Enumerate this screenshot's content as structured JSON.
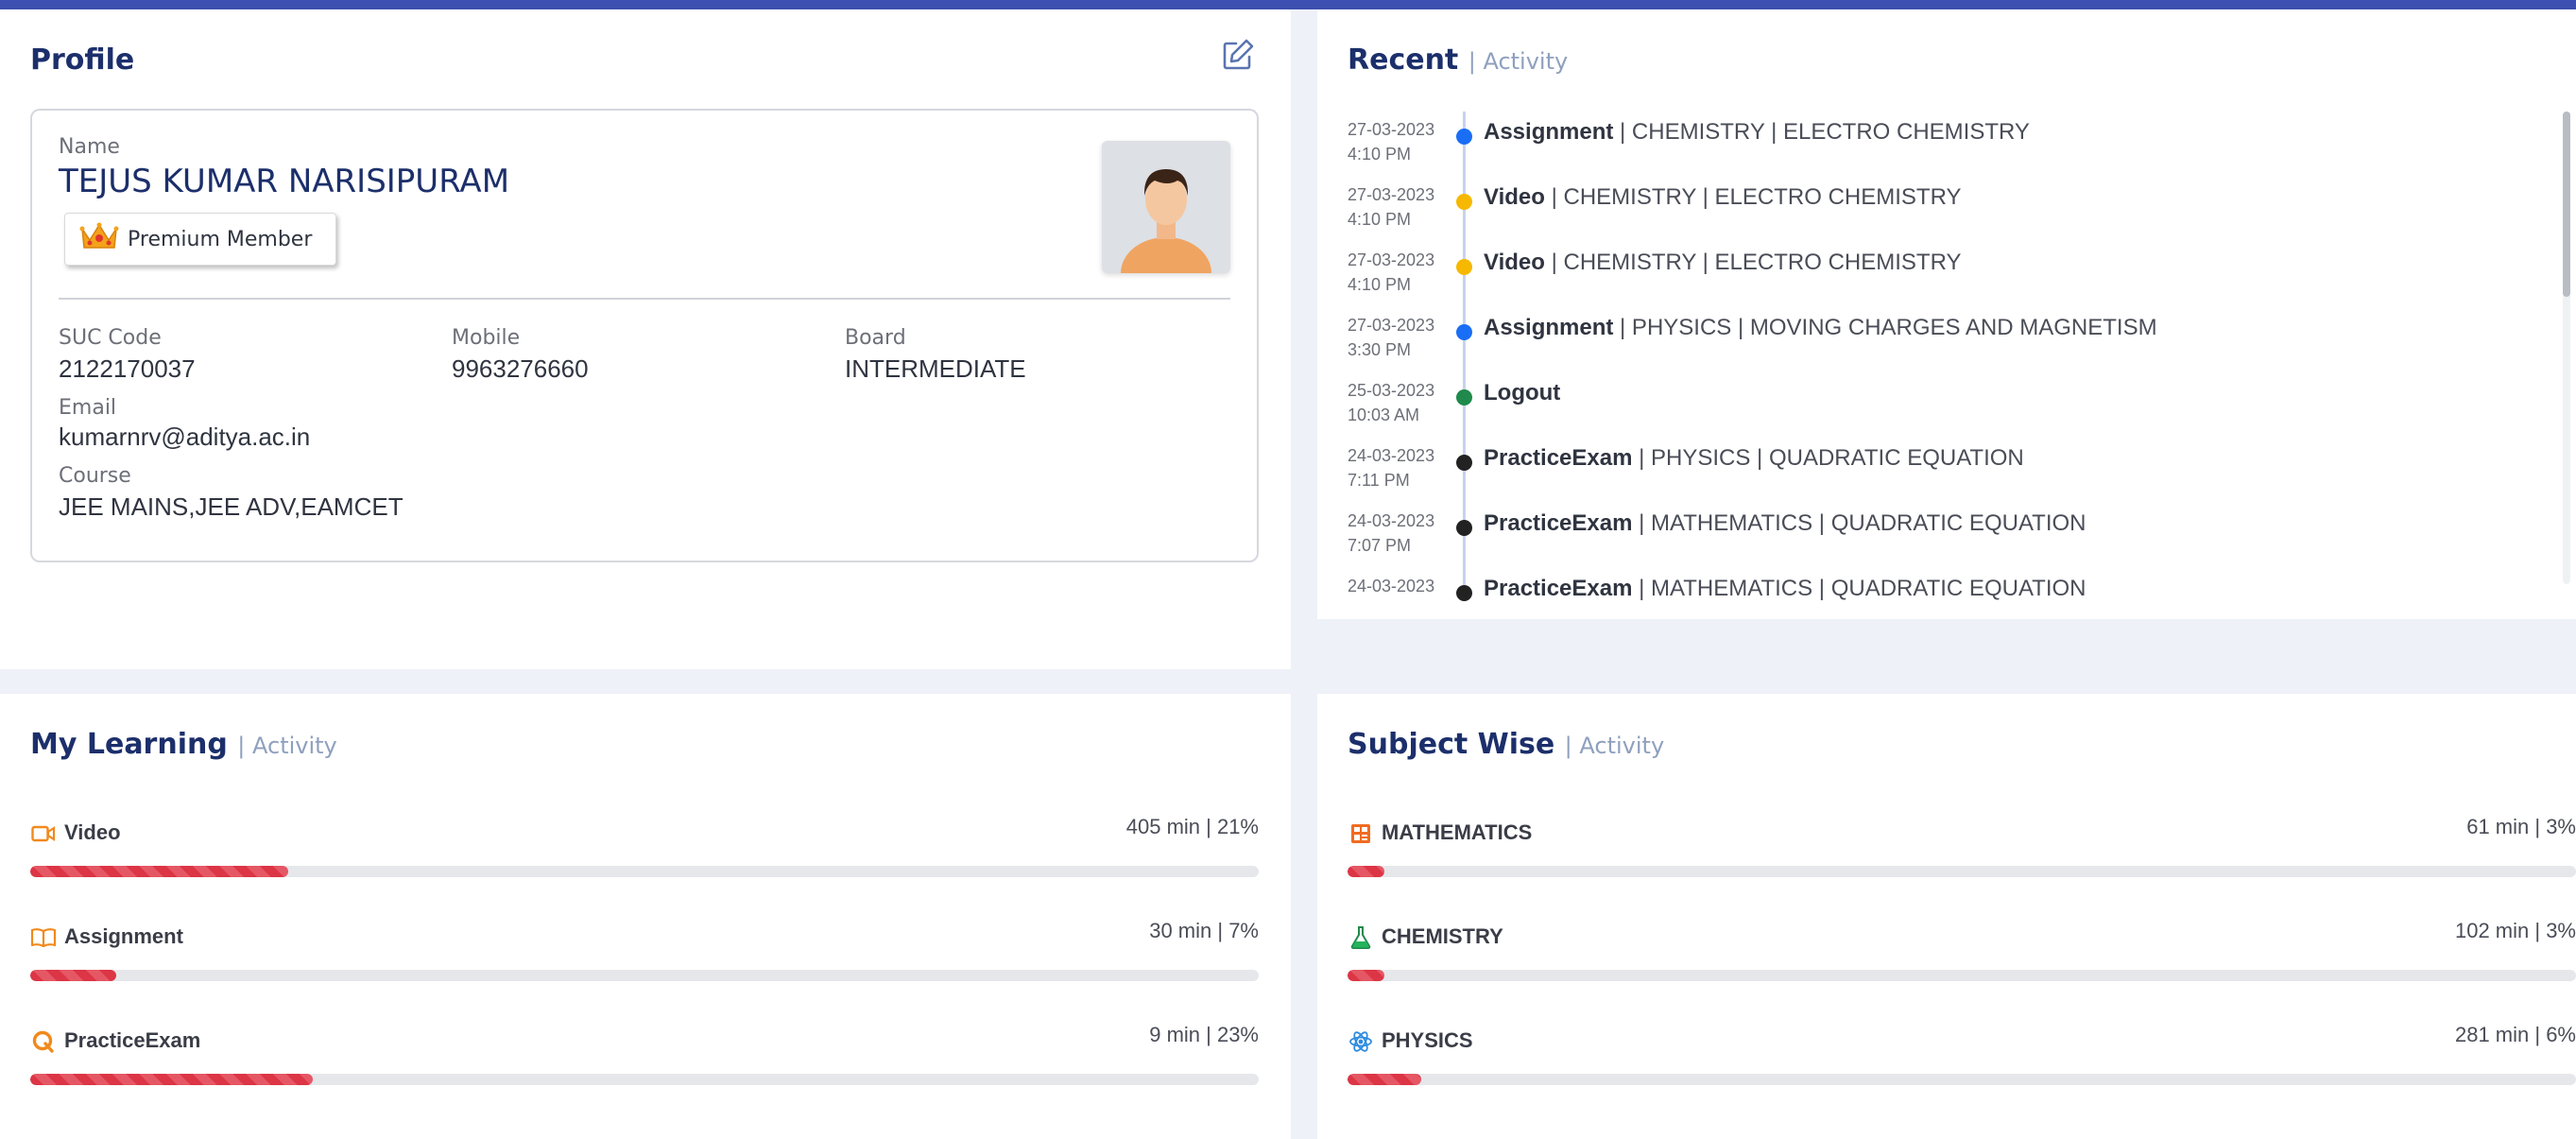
{
  "colors": {
    "accent": "#3d4fb0",
    "title": "#1c2f6b",
    "progress": "#dc3545"
  },
  "profile": {
    "title": "Profile",
    "name_label": "Name",
    "name": "TEJUS KUMAR NARISIPURAM",
    "badge": "Premium Member",
    "fields": {
      "suc_label": "SUC Code",
      "suc": "2122170037",
      "mobile_label": "Mobile",
      "mobile": "9963276660",
      "board_label": "Board",
      "board": "INTERMEDIATE",
      "email_label": "Email",
      "email": "kumarnrv@aditya.ac.in",
      "course_label": "Course",
      "course": "JEE MAINS,JEE ADV,EAMCET"
    },
    "edit_icon": "edit-icon"
  },
  "recent": {
    "title": "Recent",
    "subtitle": "| Activity",
    "items": [
      {
        "date": "27-03-2023",
        "time": "4:10 PM",
        "type": "Assignment",
        "detail": "| CHEMISTRY | ELECTRO CHEMISTRY",
        "dot": "#1a6ef5"
      },
      {
        "date": "27-03-2023",
        "time": "4:10 PM",
        "type": "Video",
        "detail": "| CHEMISTRY | ELECTRO CHEMISTRY",
        "dot": "#f6b800"
      },
      {
        "date": "27-03-2023",
        "time": "4:10 PM",
        "type": "Video",
        "detail": "| CHEMISTRY | ELECTRO CHEMISTRY",
        "dot": "#f6b800"
      },
      {
        "date": "27-03-2023",
        "time": "3:30 PM",
        "type": "Assignment",
        "detail": "| PHYSICS | MOVING CHARGES AND MAGNETISM",
        "dot": "#1a6ef5"
      },
      {
        "date": "25-03-2023",
        "time": "10:03 AM",
        "type": "Logout",
        "detail": "",
        "dot": "#1f8a4c"
      },
      {
        "date": "24-03-2023",
        "time": "7:11 PM",
        "type": "PracticeExam",
        "detail": "| PHYSICS | QUADRATIC EQUATION",
        "dot": "#222222"
      },
      {
        "date": "24-03-2023",
        "time": "7:07 PM",
        "type": "PracticeExam",
        "detail": "| MATHEMATICS | QUADRATIC EQUATION",
        "dot": "#222222"
      },
      {
        "date": "24-03-2023",
        "time": "",
        "type": "PracticeExam",
        "detail": "| MATHEMATICS | QUADRATIC EQUATION",
        "dot": "#222222"
      }
    ]
  },
  "learning": {
    "title": "My Learning",
    "subtitle": "| Activity",
    "items": [
      {
        "label": "Video",
        "stat": "405 min | 21%",
        "percent": 21,
        "icon": "video-icon"
      },
      {
        "label": "Assignment",
        "stat": "30 min | 7%",
        "percent": 7,
        "icon": "book-icon"
      },
      {
        "label": "PracticeExam",
        "stat": "9 min | 23%",
        "percent": 23,
        "icon": "quiz-icon"
      }
    ]
  },
  "subjects": {
    "title": "Subject Wise",
    "subtitle": "| Activity",
    "items": [
      {
        "label": "MATHEMATICS",
        "stat": "61 min | 3%",
        "percent": 3,
        "icon": "calculator-icon"
      },
      {
        "label": "CHEMISTRY",
        "stat": "102 min | 3%",
        "percent": 3,
        "icon": "flask-icon"
      },
      {
        "label": "PHYSICS",
        "stat": "281 min | 6%",
        "percent": 6,
        "icon": "atom-icon"
      }
    ]
  }
}
